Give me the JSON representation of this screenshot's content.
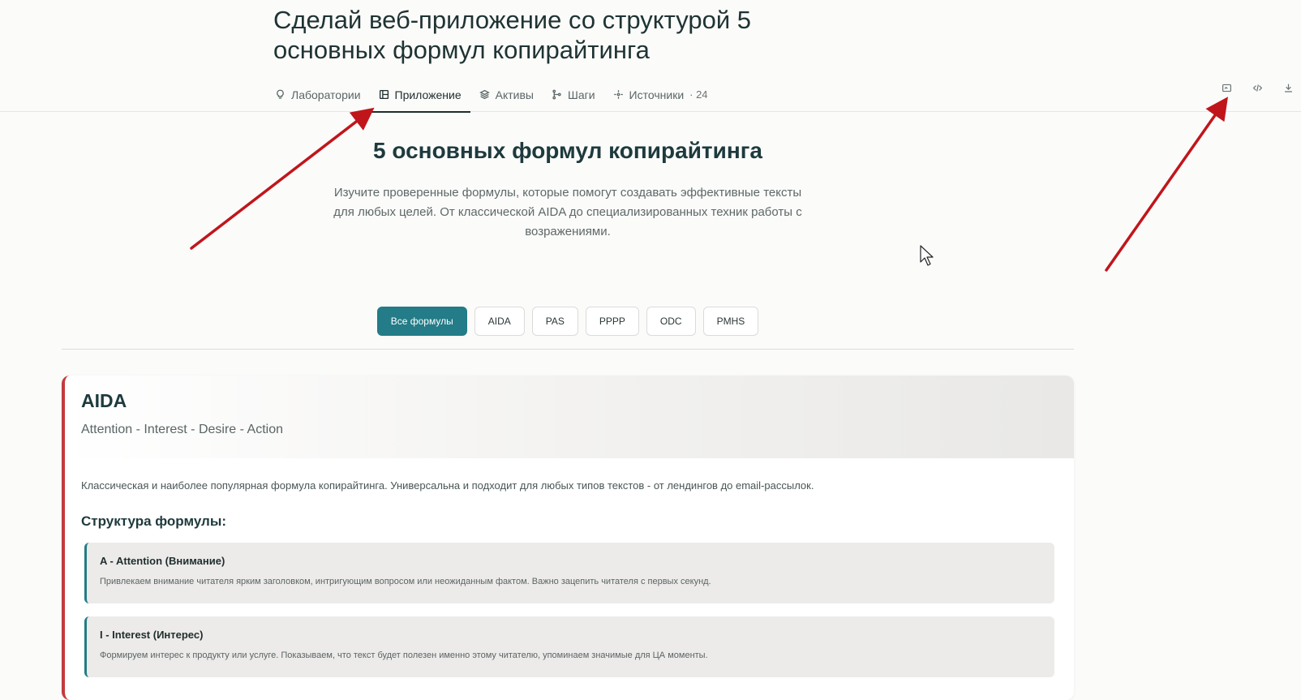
{
  "header": {
    "title": "Сделай веб-приложение со структурой 5 основных формул копирайтинга",
    "tabs": [
      {
        "label": "Лаборатории",
        "icon": "bulb-icon"
      },
      {
        "label": "Приложение",
        "icon": "app-icon"
      },
      {
        "label": "Активы",
        "icon": "layers-icon"
      },
      {
        "label": "Шаги",
        "icon": "steps-icon"
      },
      {
        "label": "Источники",
        "count": "· 24",
        "icon": "sources-icon"
      }
    ],
    "active_tab": "Приложение",
    "actions": [
      "preview-icon",
      "code-icon",
      "download-icon"
    ]
  },
  "app": {
    "title": "5 основных формул копирайтинга",
    "subtitle": "Изучите проверенные формулы, которые помогут создавать эффективные тексты для любых целей. От классической AIDA до специализированных техник работы с возражениями.",
    "filters": [
      "Все формулы",
      "AIDA",
      "PAS",
      "PPPP",
      "ODC",
      "PMHS"
    ],
    "active_filter": "Все формулы",
    "card": {
      "title": "AIDA",
      "expansion": "Attention - Interest - Desire - Action",
      "description": "Классическая и наиболее популярная формула копирайтинга. Универсальна и подходит для любых типов текстов - от лендингов до email-рассылок.",
      "structure_title": "Структура формулы:",
      "steps": [
        {
          "title": "A - Attention (Внимание)",
          "text": "Привлекаем внимание читателя ярким заголовком, интригующим вопросом или неожиданным фактом. Важно зацепить читателя с первых секунд."
        },
        {
          "title": "I - Interest (Интерес)",
          "text": "Формируем интерес к продукту или услуге. Показываем, что текст будет полезен именно этому читателю, упоминаем значимые для ЦА моменты."
        }
      ]
    }
  },
  "colors": {
    "accent": "#237c87",
    "card_border": "#c43a3d",
    "annotation_arrow": "#c0161b"
  }
}
